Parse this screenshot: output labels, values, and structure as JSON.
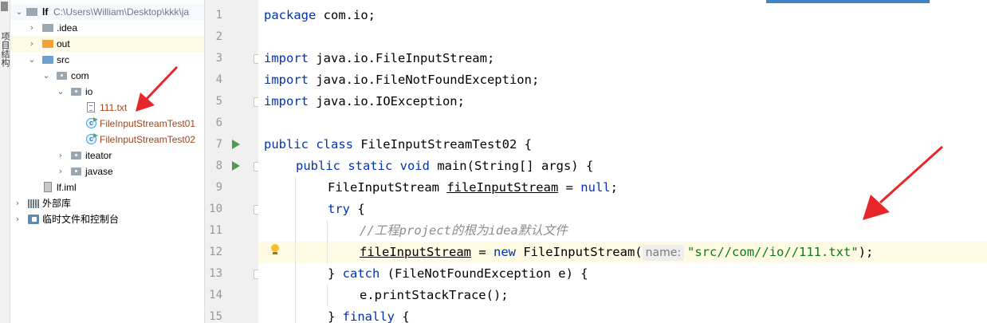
{
  "vstrip": {
    "label": "项目结构"
  },
  "tree": {
    "root": {
      "name": "lf",
      "path": "C:\\Users\\William\\Desktop\\kkk\\ja"
    },
    "items": [
      {
        "label": ".idea"
      },
      {
        "label": "out"
      },
      {
        "label": "src"
      },
      {
        "label": "com"
      },
      {
        "label": "io"
      },
      {
        "label": "111.txt"
      },
      {
        "label": "FileInputStreamTest01"
      },
      {
        "label": "FileInputStreamTest02"
      },
      {
        "label": "iteator"
      },
      {
        "label": "javase"
      },
      {
        "label": "lf.iml"
      },
      {
        "label": "外部库"
      },
      {
        "label": "临时文件和控制台"
      }
    ]
  },
  "editor": {
    "line_numbers": [
      "1",
      "2",
      "3",
      "4",
      "5",
      "6",
      "7",
      "8",
      "9",
      "10",
      "11",
      "12",
      "13",
      "14",
      "15"
    ],
    "lines": {
      "l1": {
        "kw": "package",
        "rest": " com.io;"
      },
      "l3": {
        "kw": "import",
        "rest": " java.io.FileInputStream;"
      },
      "l4": {
        "kw": "import",
        "rest": " java.io.FileNotFoundException;"
      },
      "l5": {
        "kw": "import",
        "rest": " java.io.IOException;"
      },
      "l7": {
        "kw": "public class",
        "rest": " FileInputStreamTest02 {"
      },
      "l8": {
        "kw": "public static void",
        "rest": " main(String[] args) {"
      },
      "l9": {
        "a": "FileInputStream ",
        "u": "fileInputStream",
        "b": " = ",
        "kw": "null",
        "c": ";"
      },
      "l10": {
        "kw": "try",
        "rest": " {"
      },
      "l11": {
        "comment": "//工程project的根为idea默认文件"
      },
      "l12": {
        "u": "fileInputStream",
        "a": " = ",
        "kw": "new",
        "b": " FileInputStream(",
        "hint": "name:",
        "str": "\"src//com//io//111.txt\"",
        "c": ");"
      },
      "l13": {
        "a": "} ",
        "kw": "catch",
        "b": " (FileNotFoundException e) {"
      },
      "l14": {
        "a": "e.printStackTrace();"
      },
      "l15": {
        "a": "} ",
        "kw": "finally",
        "b": " {"
      }
    }
  },
  "colors": {
    "keyword": "#0033b3",
    "string": "#067d17",
    "comment": "#8c8c8c",
    "run": "#4e9a4f",
    "arrow": "#e8262a"
  }
}
